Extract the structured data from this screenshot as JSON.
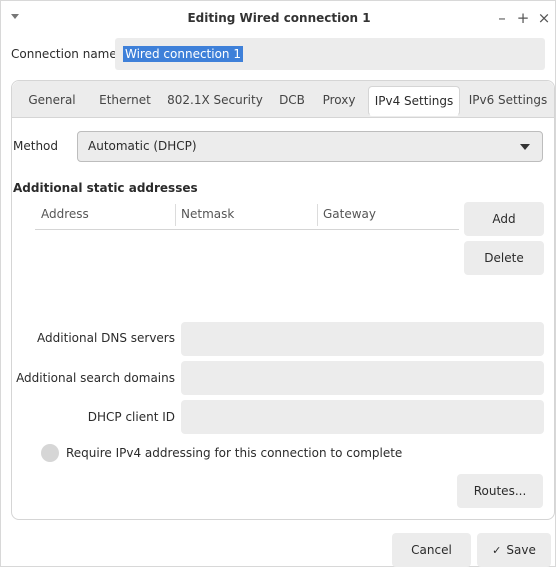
{
  "window": {
    "title": "Editing Wired connection 1",
    "controls": {
      "minimize": "–",
      "maximize": "+",
      "close": "×"
    }
  },
  "connection": {
    "label": "Connection name",
    "value": "Wired connection 1"
  },
  "tabs": [
    {
      "label": "General"
    },
    {
      "label": "Ethernet"
    },
    {
      "label": "802.1X Security"
    },
    {
      "label": "DCB"
    },
    {
      "label": "Proxy"
    },
    {
      "label": "IPv4 Settings",
      "active": true
    },
    {
      "label": "IPv6 Settings"
    }
  ],
  "method": {
    "label": "Method",
    "value": "Automatic (DHCP)"
  },
  "addresses": {
    "title": "Additional static addresses",
    "columns": [
      "Address",
      "Netmask",
      "Gateway"
    ],
    "add_label": "Add",
    "delete_label": "Delete"
  },
  "fields": {
    "dns_label": "Additional DNS servers",
    "search_label": "Additional search domains",
    "dhcp_label": "DHCP client ID"
  },
  "require": {
    "label": "Require IPv4 addressing for this connection to complete"
  },
  "buttons": {
    "routes": "Routes...",
    "cancel": "Cancel",
    "save": "Save",
    "save_icon": "✓"
  },
  "colors": {
    "selection": "#3e80d9",
    "field_bg": "#ececec"
  }
}
